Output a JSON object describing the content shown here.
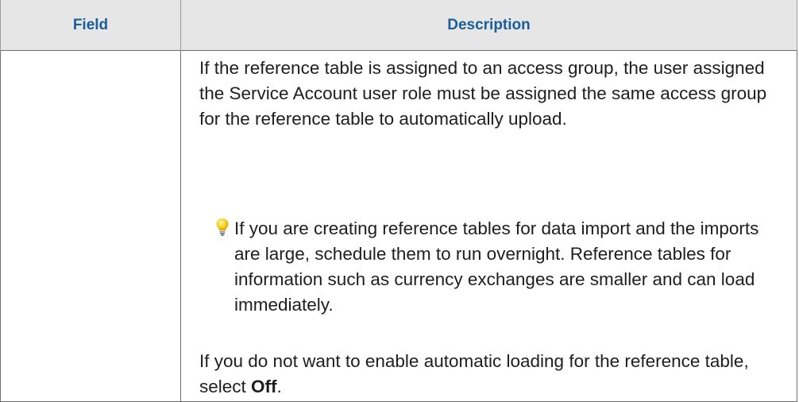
{
  "table": {
    "headers": {
      "field": "Field",
      "description": "Description"
    },
    "row": {
      "field": "",
      "paragraph_1": "If the reference table is assigned to an access group, the user assigned the Service Account user role must be assigned the same access group for the reference table to automatically upload.",
      "tip": {
        "icon": "lightbulb-icon",
        "text": "If you are creating reference tables for data import and the imports are large, schedule them to run overnight. Reference tables for information such as currency exchanges are smaller and can load immediately."
      },
      "paragraph_2": {
        "prefix": "If you do not want to enable automatic loading for the reference table, select ",
        "bold": "Off",
        "suffix": "."
      }
    }
  },
  "colors": {
    "header_bg": "#e6e6e6",
    "header_text": "#1a5e9a",
    "bulb": "#f2c400"
  }
}
